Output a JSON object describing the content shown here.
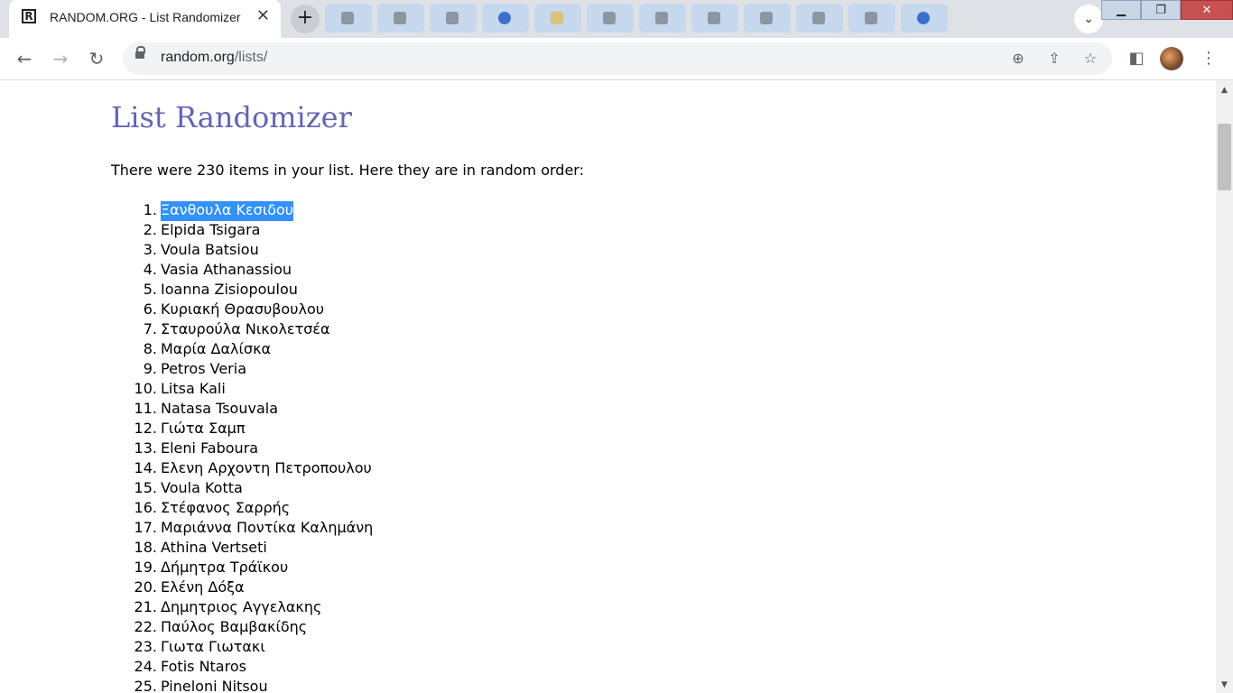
{
  "browser": {
    "tab_title": "RANDOM.ORG - List Randomizer",
    "favicon_letter": "R",
    "url_host": "random.org",
    "url_path": "/lists/"
  },
  "page": {
    "heading": "List Randomizer",
    "intro": "There were 230 items in your list. Here they are in random order:",
    "items": [
      "Ξανθουλα Κεσιδου",
      "Elpida Tsigara",
      "Voula Batsiou",
      "Vasia Athanassiou",
      "Ioanna Zisiopoulou",
      "Κυριακή Θρασυβουλου",
      "Σταυρούλα Νικολετσέα",
      "Μαρία Δαλίσκα",
      "Petros Veria",
      "Litsa Kali",
      "Natasa Tsouvala",
      "Γιώτα Σαμπ",
      "Eleni Faboura",
      "Ελενη Αρχοντη Πετροπουλου",
      "Voula Kotta",
      "Στέφανος Σαρρής",
      "Μαριάννα Ποντίκα Καλημάνη",
      "Athina Vertseti",
      "Δήμητρα Τράϊκου",
      "Ελένη Δόξα",
      "Δημητριος Αγγελακης",
      "Παύλος Βαμβακίδης",
      "Γιωτα Γιωτακι",
      "Fotis Ntaros",
      "Pineloni Nitsou"
    ]
  },
  "icons": {
    "back": "back-arrow-icon",
    "forward": "forward-arrow-icon",
    "reload": "reload-icon",
    "zoom": "zoom-icon",
    "share": "share-icon",
    "bookmark": "star-icon",
    "side_panel": "side-panel-icon",
    "menu": "kebab-menu-icon"
  },
  "colors": {
    "heading": "#6464b4",
    "selection": "#3390ff"
  }
}
